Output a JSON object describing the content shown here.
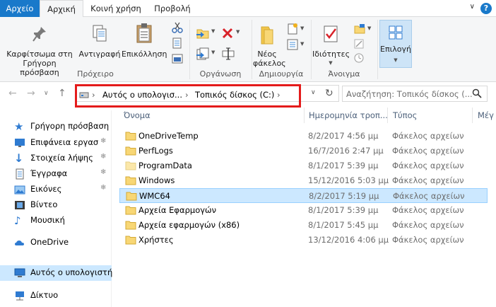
{
  "tabs": {
    "file": "Αρχείο",
    "home": "Αρχική",
    "share": "Κοινή χρήση",
    "view": "Προβολή"
  },
  "ribbon": {
    "pin_label_1": "Καρφίτσωμα στη",
    "pin_label_2": "Γρήγορη πρόσβαση",
    "copy_label": "Αντιγραφή",
    "paste_label": "Επικόλληση",
    "new_folder_1": "Νέος",
    "new_folder_2": "φάκελος",
    "properties_label": "Ιδιότητες",
    "select_label": "Επιλογή",
    "group_clipboard": "Πρόχειρο",
    "group_organize": "Οργάνωση",
    "group_new": "Δημιουργία",
    "group_open": "Άνοιγμα"
  },
  "address": {
    "crumb_pc": "Αυτός ο υπολογισ...",
    "crumb_disk": "Τοπικός δίσκος (C:)",
    "search_placeholder": "Αναζήτηση: Τοπικός δίσκος (..."
  },
  "columns": {
    "name": "Όνομα",
    "date": "Ημερομηνία τροπ...",
    "type": "Τύπος",
    "size": "Μέγ"
  },
  "nav": {
    "quick_access": "Γρήγορη πρόσβαση",
    "desktop": "Επιφάνεια εργασ",
    "downloads": "Στοιχεία λήψης",
    "documents": "Έγγραφα",
    "pictures": "Εικόνες",
    "videos": "Βίντεο",
    "music": "Μουσική",
    "onedrive": "OneDrive",
    "this_pc": "Αυτός ο υπολογιστή",
    "network": "Δίκτυο"
  },
  "files": [
    {
      "name": "OneDriveTemp",
      "date": "8/2/2017 4:56 μμ",
      "type": "Φάκελος αρχείων"
    },
    {
      "name": "PerfLogs",
      "date": "16/7/2016 2:47 μμ",
      "type": "Φάκελος αρχείων"
    },
    {
      "name": "ProgramData",
      "date": "8/1/2017 5:39 μμ",
      "type": "Φάκελος αρχείων"
    },
    {
      "name": "Windows",
      "date": "15/12/2016 5:03 μμ",
      "type": "Φάκελος αρχείων"
    },
    {
      "name": "WMC64",
      "date": "8/2/2017 5:19 μμ",
      "type": "Φάκελος αρχείων"
    },
    {
      "name": "Αρχεία Εφαρμογών",
      "date": "8/1/2017 5:39 μμ",
      "type": "Φάκελος αρχείων"
    },
    {
      "name": "Αρχεία εφαρμογών (x86)",
      "date": "8/1/2017 5:45 μμ",
      "type": "Φάκελος αρχείων"
    },
    {
      "name": "Χρήστες",
      "date": "13/12/2016 4:06 μμ",
      "type": "Φάκελος αρχείων"
    }
  ],
  "colors": {
    "accent": "#1979ca",
    "selection": "#cce8ff",
    "highlight": "#e41b1b",
    "folder": "#f8d775"
  }
}
